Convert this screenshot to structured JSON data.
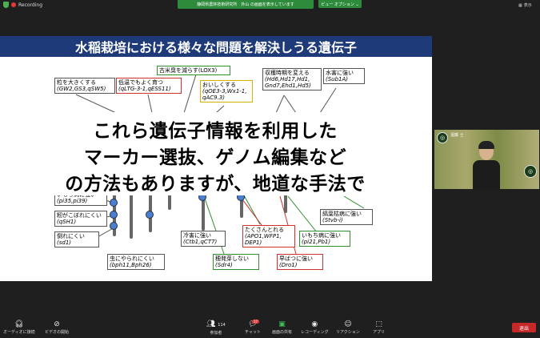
{
  "topbar": {
    "recording_label": "Recording",
    "share_text": "静岡県農林技術研究所　外山 の画面を表示しています",
    "view_options": "ビュー オプション ⌄",
    "display_label": "表示"
  },
  "slide": {
    "title": "水稲栽培における様々な問題を解決しうる遺伝子",
    "boxes": [
      {
        "label": "粒を大きくする",
        "genes": "(GW2,GS3,qSW5)"
      },
      {
        "label": "低温でもよく育つ",
        "genes": "(qLTG-3-1,qESS11)"
      },
      {
        "label": "古米臭を減らす(LOX3)",
        "genes": ""
      },
      {
        "label": "おいしくする",
        "genes": "(qOE3-3,Wx1-1, qAC9.3)"
      },
      {
        "label": "収穫時期を変える",
        "genes": "(Hd6,Hd17,Hd1, Gnd7,Ehd1,Hd5)"
      },
      {
        "label": "水害に強い",
        "genes": "(Sub1A)"
      },
      {
        "label": "いもち病に強い",
        "genes": "(pi35,pi39)"
      },
      {
        "label": "籾がこぼれにくい",
        "genes": "(qSH1)"
      },
      {
        "label": "倒れにくい",
        "genes": "(sd1)"
      },
      {
        "label": "虫にやられにくい",
        "genes": "(bph11,Bph26)"
      },
      {
        "label": "冷害に強い",
        "genes": "(Ctb1,qCT7)"
      },
      {
        "label": "たくさんとれる",
        "genes": "(APO1,WFP1, DEP1)"
      },
      {
        "label": "穂発芽しない",
        "genes": "(Sdr4)"
      },
      {
        "label": "早ばつに強い",
        "genes": "(Dro1)"
      },
      {
        "label": "いもち病に強い",
        "genes": "(pi21,Pb1)"
      },
      {
        "label": "縞葉枯病に強い",
        "genes": "(Stvb-i)"
      }
    ],
    "overlay": [
      "これら遺伝子情報を利用した",
      "マーカー選抜、ゲノム編集など",
      "の方法もありますが、地道な手法で"
    ]
  },
  "video": {
    "name": "遠藤 士"
  },
  "toolbar": {
    "audio": "オーディオに接続",
    "video": "ビデオの開始",
    "participants": "参加者",
    "participants_count": "114",
    "chat": "チャット",
    "chat_badge": "17",
    "share": "画面の共有",
    "record": "レコーディング",
    "reaction": "リアクション",
    "apps": "アプリ",
    "exit": "退出"
  },
  "colors": {
    "slide_title_bg": "#1e3a78",
    "share_green": "#2e8b3c",
    "exit_red": "#c62828"
  }
}
